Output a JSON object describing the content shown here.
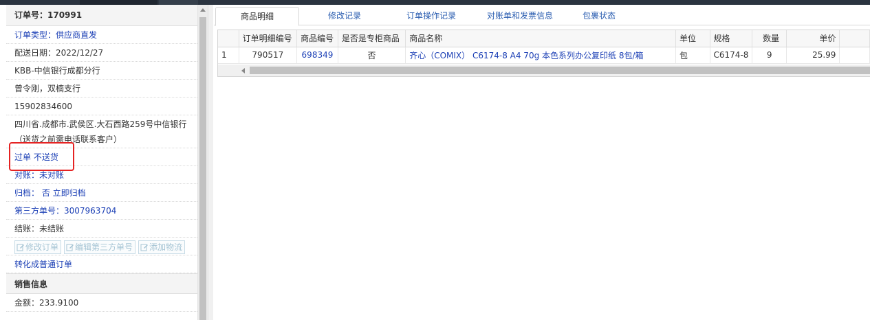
{
  "order": {
    "header": "订单号：170991",
    "type": "订单类型：供应商直发",
    "delivery_date": "配送日期：2022/12/27",
    "company": "KBB-中信银行成都分行",
    "contact": "曾令刚，双楠支行",
    "phone": "15902834600",
    "address": "四川省.成都市.武侯区.大石西路259号中信银行（送货之前需电话联系客户）",
    "process_status": "过单 不送货",
    "reconcile": "对账：未对账",
    "archive": "归档： 否 立即归档",
    "third_party_no": "第三方单号：3007963704",
    "settlement": "结账：未结账",
    "buttons": {
      "edit_order": "修改订单",
      "edit_third_no": "编辑第三方单号",
      "add_logistics": "添加物流"
    },
    "convert_link": "转化成普通订单"
  },
  "sales": {
    "title": "销售信息",
    "amount": "金额：233.9100"
  },
  "tabs": [
    "商品明细",
    "修改记录",
    "订单操作记录",
    "对账单和发票信息",
    "包裹状态"
  ],
  "table": {
    "columns": [
      "",
      "订单明细编号",
      "商品编号",
      "是否是专柜商品",
      "商品名称",
      "单位",
      "规格",
      "数量",
      "单价",
      ""
    ],
    "rows": [
      [
        "1",
        "790517",
        "698349",
        "否",
        "齐心（COMIX） C6174-8 A4 70g 本色系列办公复印纸 8包/箱",
        "包",
        "C6174-8",
        "9",
        "25.99",
        ""
      ]
    ]
  },
  "colors": {
    "link": "#1b3fb5",
    "highlight_box": "#e52222"
  }
}
